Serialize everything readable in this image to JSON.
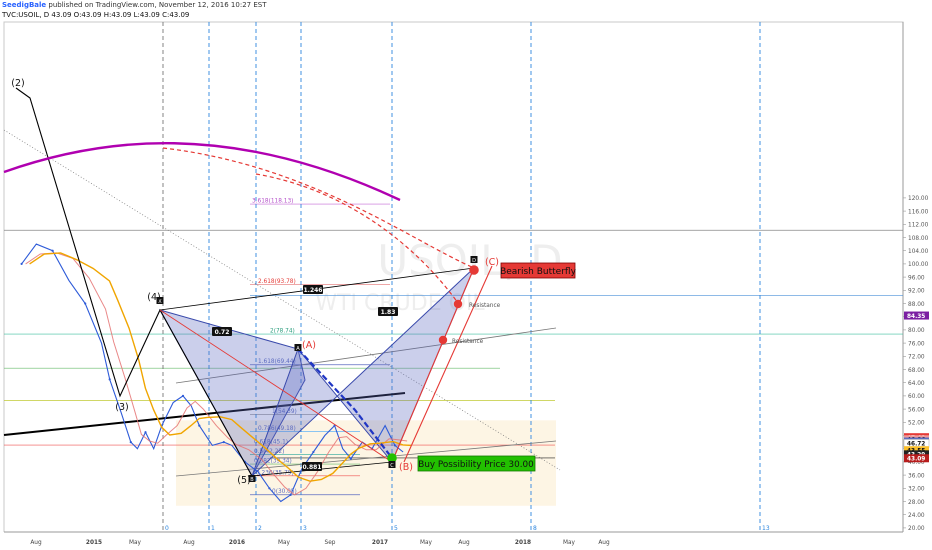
{
  "header": {
    "author": "SeedigBale",
    "published": "published on TradingView.com, November 12, 2016 10:27 EST",
    "symbol_line": "TVC:USOIL, D  43.09  O:43.09  H:43.09  L:43.09  C:43.09"
  },
  "watermark": {
    "symbol": "USOIL, D",
    "name": "WTI CRUDE OIL"
  },
  "colors": {
    "price": "#2e5bd8",
    "ma_fast": "#e57373",
    "ma_slow": "#f0a500",
    "arc": "#b000b0",
    "pattern": "#5c6bc0",
    "red": "#e53935",
    "green": "#22c000"
  },
  "chart_data": {
    "type": "line",
    "x_ticks": [
      "Aug",
      "2015",
      "May",
      "Aug",
      "2016",
      "May",
      "Sep",
      "2017",
      "May",
      "Aug",
      "2018",
      "May",
      "Aug"
    ],
    "y_ticks": [
      16,
      20,
      24,
      28,
      32,
      36,
      40,
      44,
      48,
      52,
      56,
      60,
      64,
      68,
      72,
      76,
      80,
      84,
      88,
      92,
      96,
      100,
      104,
      108,
      112,
      116,
      120
    ],
    "ylim": [
      14,
      121
    ],
    "price_series": [
      {
        "t": 0.1,
        "v": 100
      },
      {
        "t": 1.0,
        "v": 106
      },
      {
        "t": 2.0,
        "v": 104
      },
      {
        "t": 3.0,
        "v": 95
      },
      {
        "t": 4.0,
        "v": 88
      },
      {
        "t": 5.0,
        "v": 76
      },
      {
        "t": 5.5,
        "v": 65
      },
      {
        "t": 6.2,
        "v": 55
      },
      {
        "t": 6.8,
        "v": 46
      },
      {
        "t": 7.2,
        "v": 44
      },
      {
        "t": 7.7,
        "v": 49
      },
      {
        "t": 8.2,
        "v": 44
      },
      {
        "t": 8.7,
        "v": 51
      },
      {
        "t": 9.4,
        "v": 58
      },
      {
        "t": 10.0,
        "v": 60
      },
      {
        "t": 10.5,
        "v": 57
      },
      {
        "t": 11.0,
        "v": 51
      },
      {
        "t": 11.8,
        "v": 45
      },
      {
        "t": 12.5,
        "v": 46
      },
      {
        "t": 13.0,
        "v": 45
      },
      {
        "t": 13.8,
        "v": 40
      },
      {
        "t": 14.6,
        "v": 37
      },
      {
        "t": 15.3,
        "v": 32
      },
      {
        "t": 16.0,
        "v": 28
      },
      {
        "t": 16.6,
        "v": 30
      },
      {
        "t": 17.3,
        "v": 38
      },
      {
        "t": 18.0,
        "v": 43
      },
      {
        "t": 18.7,
        "v": 48
      },
      {
        "t": 19.3,
        "v": 51
      },
      {
        "t": 19.8,
        "v": 44
      },
      {
        "t": 20.3,
        "v": 41
      },
      {
        "t": 21.0,
        "v": 46
      },
      {
        "t": 21.6,
        "v": 44
      },
      {
        "t": 22.4,
        "v": 51
      },
      {
        "t": 23.0,
        "v": 45
      },
      {
        "t": 23.5,
        "v": 43
      }
    ],
    "fib_levels": [
      {
        "label": "3.618(118.13)",
        "value": 118.13
      },
      {
        "label": "2.618(93.78)",
        "value": 93.78
      },
      {
        "label": "2(78.74)",
        "value": 78.74
      },
      {
        "label": "1.618(69.44)",
        "value": 69.44
      },
      {
        "label": "1(54.39)",
        "value": 54.39
      },
      {
        "label": "0.786(49.18)",
        "value": 49.18
      },
      {
        "label": "0.618(45.1)",
        "value": 45.1
      },
      {
        "label": "0.5(42.22)",
        "value": 42.22
      },
      {
        "label": "0.382(39.34)",
        "value": 39.34
      },
      {
        "label": "0.236(35.79)",
        "value": 35.79
      },
      {
        "label": "0(30.05)",
        "value": 30.05
      }
    ],
    "wave_labels": [
      "(2)",
      "(3)",
      "(4)",
      "(5)",
      "(A)",
      "(B)",
      "(C)"
    ],
    "pattern_points": [
      "X",
      "A",
      "B",
      "C",
      "D"
    ],
    "ratios": [
      "0.72",
      "1.83",
      "1.246",
      "0.881"
    ],
    "annotations": {
      "bearish": "Bearish Butterfly",
      "buy": "Buy Possibility Price 30.00",
      "resistance": "Resistance"
    },
    "time_cycles": [
      "0",
      "1",
      "2",
      "3",
      "5",
      "8",
      "13"
    ],
    "price_badges": [
      {
        "text": "84.35",
        "value": 84.35,
        "bg": "#7b1fa2"
      },
      {
        "text": "47.49",
        "value": 47.49,
        "bg": "#e53935"
      },
      {
        "text": "46.86",
        "value": 46.86,
        "bg": "#ef9a9a"
      },
      {
        "text": "46.17",
        "value": 46.17,
        "bg": "#5c6bc0"
      },
      {
        "text": "46.72",
        "value": 45.6,
        "bg": "#ffffff"
      },
      {
        "text": "43.55",
        "value": 43.55,
        "bg": "#fbc02d"
      },
      {
        "text": "43.29",
        "value": 42.3,
        "bg": "#222222"
      },
      {
        "text": "43.09",
        "value": 41.1,
        "bg": "#b71c1c"
      }
    ]
  }
}
